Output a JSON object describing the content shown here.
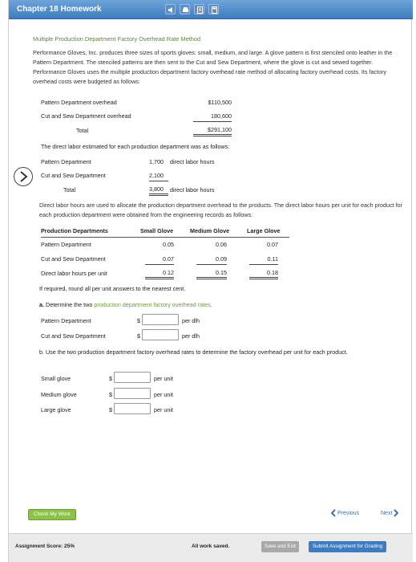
{
  "window": {
    "title": "Chapter 18 Homework"
  },
  "problem": {
    "heading": "Multiple Production Department Factory Overhead Rate Method",
    "intro": "Performance Gloves, Inc. produces three sizes of sports gloves: small, medium, and large. A glove pattern is first stenciled onto leather in the Pattern Department. The stenciled patterns are then sent to the Cut and Sew Department, where the glove is cut and sewed together. Performance Gloves uses the multiple production department factory overhead rate method of allocating factory overhead costs. Its factory overhead costs were budgeted as follows:",
    "overhead": [
      {
        "label": "Pattern Department overhead",
        "value": "$110,500"
      },
      {
        "label": "Cut and Sew Department overhead",
        "value": "180,600"
      },
      {
        "label": "Total",
        "value": "$291,100"
      }
    ],
    "dl_intro": "The direct labor estimated for each production department was as follows:",
    "direct_labor": [
      {
        "label": "Pattern Department",
        "value": "1,700",
        "unit": "direct labor hours"
      },
      {
        "label": "Cut and Sew Department",
        "value": "2,100",
        "unit": ""
      },
      {
        "label": "Total",
        "value": "3,800",
        "unit": "direct labor hours"
      }
    ],
    "dlh_para": "Direct labor hours are used to allocate the production department overhead to the products. The direct labor hours per unit for each product for each production department were obtained from the engineering records as follows:",
    "table": {
      "headers": [
        "Production Departments",
        "Small Glove",
        "Medium Glove",
        "Large Glove"
      ],
      "rows": [
        [
          "Pattern Department",
          "0.05",
          "0.06",
          "0.07"
        ],
        [
          "Cut and Sew Department",
          "0.07",
          "0.09",
          "0.11"
        ],
        [
          "Direct labor hours per unit",
          "0.12",
          "0.15",
          "0.18"
        ]
      ]
    },
    "round_note": "If required, round all per unit answers to the nearest cent.",
    "part_a": {
      "prefix": "a.",
      "text_start": "Determine the two ",
      "text_link": "production department factory overhead rates",
      "text_end": ".",
      "items": [
        {
          "label": "Pattern Department",
          "currency": "$",
          "unit": "per dlh",
          "value": ""
        },
        {
          "label": "Cut and Sew Department",
          "currency": "$",
          "unit": "per dlh",
          "value": ""
        }
      ]
    },
    "part_b": {
      "text": "b.  Use the two production department factory overhead rates to determine the factory overhead per unit for each product.",
      "items": [
        {
          "label": "Small glove",
          "currency": "$",
          "unit": "per unit",
          "value": ""
        },
        {
          "label": "Medium glove",
          "currency": "$",
          "unit": "per unit",
          "value": ""
        },
        {
          "label": "Large glove",
          "currency": "$",
          "unit": "per unit",
          "value": ""
        }
      ]
    }
  },
  "buttons": {
    "check": "Check My Work",
    "previous": "Previous",
    "next": "Next",
    "save_exit": "Save and Exit",
    "submit": "Submit Assignment for Grading"
  },
  "footer": {
    "score": "Assignment Score: 25%",
    "saved": "All work saved."
  }
}
